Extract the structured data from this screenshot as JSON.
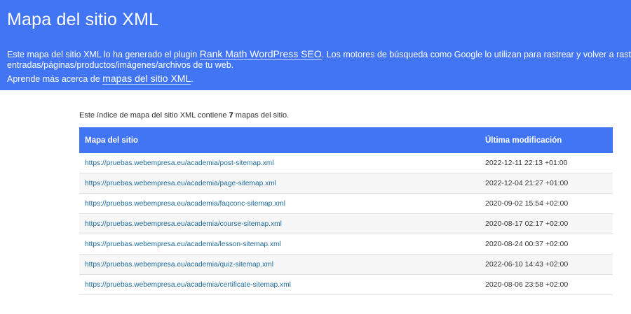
{
  "header": {
    "title": "Mapa del sitio XML",
    "intro_before_link": "Este mapa del sitio XML lo ha generado el plugin ",
    "plugin_link": "Rank Math WordPress SEO",
    "intro_after_link": ". Los motores de búsqueda como Google lo utilizan para rastrear y volver a rastrear",
    "intro_line2": "entradas/páginas/productos/imágenes/archivos de tu web.",
    "learn_before": "Aprende más acerca de ",
    "learn_link": "mapas del sitio XML",
    "learn_after": "."
  },
  "summary": {
    "before": "Este índice de mapa del sitio XML contiene ",
    "count": "7",
    "after": " mapas del sitio."
  },
  "table": {
    "columns": [
      "Mapa del sitio",
      "Última modificación"
    ],
    "rows": [
      {
        "loc": "https://pruebas.webempresa.eu/academia/post-sitemap.xml",
        "lastmod": "2022-12-11 22:13 +01:00"
      },
      {
        "loc": "https://pruebas.webempresa.eu/academia/page-sitemap.xml",
        "lastmod": "2022-12-04 21:27 +01:00"
      },
      {
        "loc": "https://pruebas.webempresa.eu/academia/faqconc-sitemap.xml",
        "lastmod": "2020-09-02 15:54 +02:00"
      },
      {
        "loc": "https://pruebas.webempresa.eu/academia/course-sitemap.xml",
        "lastmod": "2020-08-17 02:17 +02:00"
      },
      {
        "loc": "https://pruebas.webempresa.eu/academia/lesson-sitemap.xml",
        "lastmod": "2020-08-24 00:37 +02:00"
      },
      {
        "loc": "https://pruebas.webempresa.eu/academia/quiz-sitemap.xml",
        "lastmod": "2022-06-10 14:43 +02:00"
      },
      {
        "loc": "https://pruebas.webempresa.eu/academia/certificate-sitemap.xml",
        "lastmod": "2020-08-06 23:58 +02:00"
      }
    ]
  },
  "colors": {
    "accent": "#4275f4",
    "link": "#1d6b99"
  }
}
